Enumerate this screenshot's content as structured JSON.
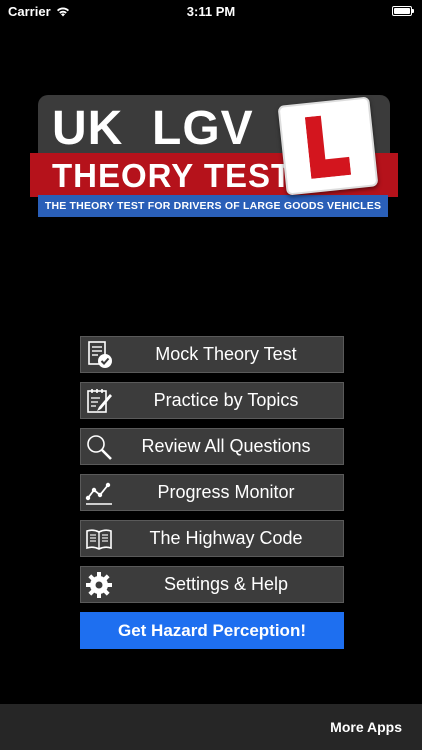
{
  "status_bar": {
    "carrier": "Carrier",
    "time": "3:11 PM",
    "battery_level": 1.0
  },
  "logo": {
    "title_line1": "UK  LGV",
    "title_line2": "THEORY TEST",
    "subtitle": "THE THEORY TEST FOR DRIVERS OF LARGE GOODS VEHICLES",
    "colors": {
      "band": "#b5121b",
      "subtitle_bar": "#2a5fb8",
      "plate_letter": "#d3151e"
    }
  },
  "menu": {
    "items": [
      {
        "label": "Mock Theory Test",
        "icon": "checklist-icon"
      },
      {
        "label": "Practice by Topics",
        "icon": "notepad-pencil-icon"
      },
      {
        "label": "Review All Questions",
        "icon": "magnifier-icon"
      },
      {
        "label": "Progress Monitor",
        "icon": "line-graph-icon"
      },
      {
        "label": "The Highway Code",
        "icon": "open-book-icon"
      },
      {
        "label": "Settings & Help",
        "icon": "gear-icon"
      }
    ],
    "hazard_label": "Get Hazard Perception!",
    "hazard_color": "#1e6ff0"
  },
  "footer": {
    "more_apps": "More Apps"
  }
}
